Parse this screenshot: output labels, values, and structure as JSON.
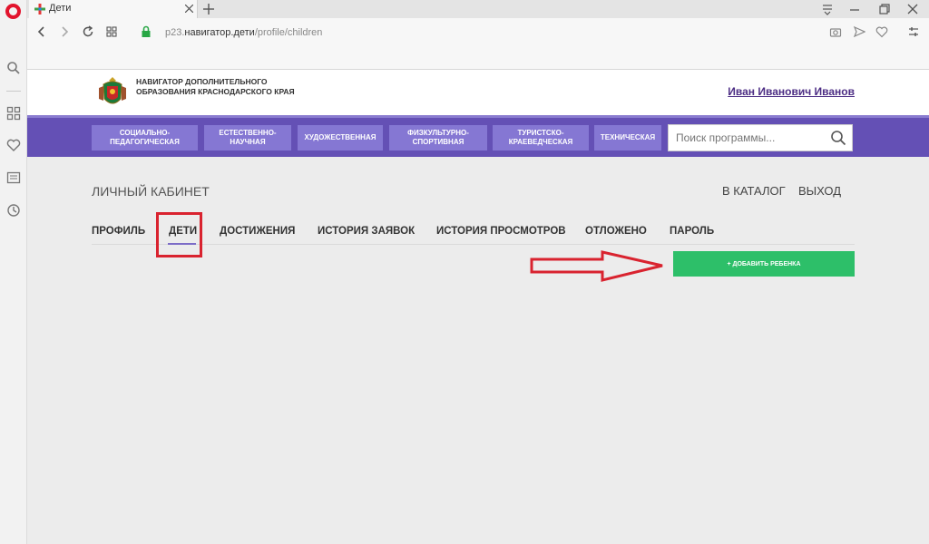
{
  "browser": {
    "tab_title": "Дети",
    "url_prefix": "p23.",
    "url_host": "навигатор.дети",
    "url_path": "/profile/children"
  },
  "site": {
    "title": "НАВИГАТОР ДОПОЛНИТЕЛЬНОГО ОБРАЗОВАНИЯ КРАСНОДАРСКОГО КРАЯ",
    "user_name": "Иван Иванович Иванов"
  },
  "nav": {
    "items": [
      {
        "label": "СОЦИАЛЬНО-ПЕДАГОГИЧЕСКАЯ"
      },
      {
        "label": "ЕСТЕСТВЕННО-НАУЧНАЯ"
      },
      {
        "label": "ХУДОЖЕСТВЕННАЯ"
      },
      {
        "label": "ФИЗКУЛЬТУРНО-СПОРТИВНАЯ"
      },
      {
        "label": "ТУРИСТСКО-КРАЕВЕДЧЕСКАЯ"
      },
      {
        "label": "ТЕХНИЧЕСКАЯ"
      }
    ],
    "search_placeholder": "Поиск программы..."
  },
  "cabinet": {
    "title": "ЛИЧНЫЙ КАБИНЕТ",
    "catalog_link": "В КАТАЛОГ",
    "logout_link": "ВЫХОД",
    "tabs": [
      {
        "label": "ПРОФИЛЬ"
      },
      {
        "label": "ДЕТИ",
        "active": true
      },
      {
        "label": "ДОСТИЖЕНИЯ"
      },
      {
        "label": "ИСТОРИЯ ЗАЯВОК"
      },
      {
        "label": "ИСТОРИЯ ПРОСМОТРОВ"
      },
      {
        "label": "ОТЛОЖЕНО"
      },
      {
        "label": "ПАРОЛЬ"
      }
    ],
    "add_child_label": "+ ДОБАВИТЬ РЕБЕНКА"
  },
  "colors": {
    "nav_band": "#6450b5",
    "nav_button": "#8577d3",
    "add_button": "#2dbf69",
    "highlight": "#d9232f",
    "user_link": "#4c2d84"
  }
}
